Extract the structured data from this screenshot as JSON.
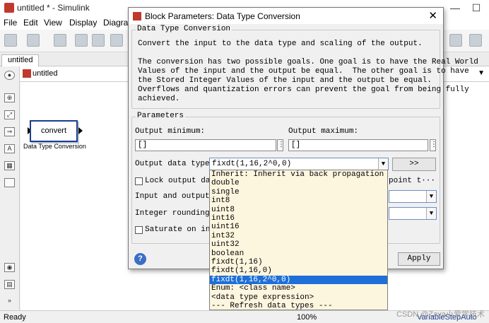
{
  "window": {
    "title": "untitled * - Simulink",
    "minimize_glyph": "—",
    "maximize_glyph": "☐"
  },
  "menu": [
    "File",
    "Edit",
    "View",
    "Display",
    "Diagram"
  ],
  "model_tab": "untitled",
  "address": "untitled",
  "block": {
    "name": "convert",
    "caption": "Data Type Conversion"
  },
  "status": {
    "left": "Ready",
    "zoom": "100%",
    "solver": "VariableStepAuto"
  },
  "dialog": {
    "title": "Block Parameters: Data Type Conversion",
    "close_glyph": "✕",
    "group_title": "Data Type Conversion",
    "description_lines": [
      "Convert the input to the data type and scaling of the output.",
      "",
      "The conversion has two possible goals. One goal is to have the Real World",
      "Values of the input and the output be equal.  The other goal is to have",
      "the Stored Integer Values of the input and the output be equal.",
      "Overflows and quantization errors can prevent the goal from being fully",
      "achieved."
    ],
    "params_title": "Parameters",
    "output_min_label": "Output minimum:",
    "output_min_value": "[]",
    "output_max_label": "Output maximum:",
    "output_max_value": "[]",
    "dtype_label": "Output data type:",
    "dtype_value": "fixdt(1,16,2^0,0)",
    "assistant_btn": ">>",
    "lock_label": "Lock output data",
    "lock_tail": "point t···",
    "input_output_label": "Input and output t",
    "rounding_label": "Integer rounding m",
    "saturate_label": "Saturate on inte",
    "apply": "Apply",
    "help_glyph": "?"
  },
  "dropdown": {
    "items": [
      "Inherit: Inherit via back propagation",
      "double",
      "single",
      "int8",
      "uint8",
      "int16",
      "uint16",
      "int32",
      "uint32",
      "boolean",
      "fixdt(1,16)",
      "fixdt(1,16,0)",
      "fixdt(1,16,2^0,0)",
      "Enum: <class name>",
      "<data type expression>",
      "--- Refresh data types ---"
    ],
    "selected_index": 12
  },
  "watermark": "CSDN @Zaya小爱学技术",
  "colors": {
    "selection": "#1e6fd9",
    "dropdown_bg": "#fdf6df",
    "block_border": "#1a3d8f"
  }
}
